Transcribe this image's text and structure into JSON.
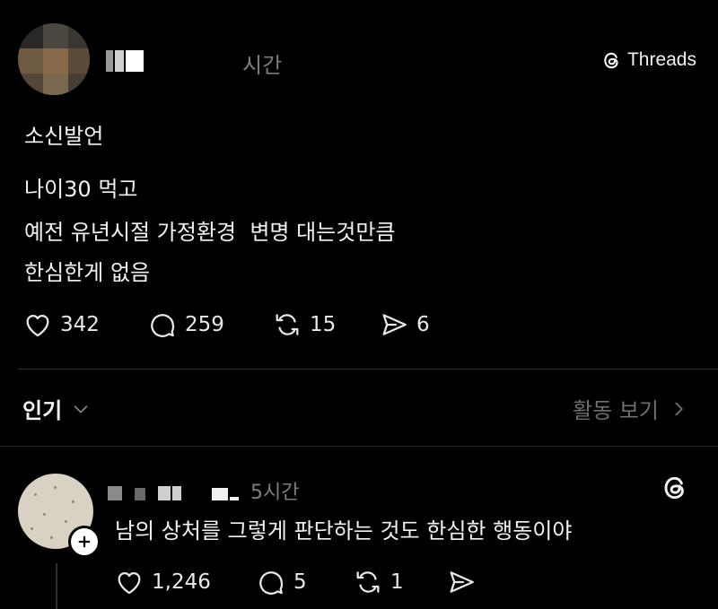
{
  "post": {
    "time": "시간",
    "source": "Threads",
    "lines": [
      "소신발언",
      "나이30 먹고",
      "예전 유년시절 가정환경  변명 대는것만큼",
      "한심한게 없음"
    ],
    "likes": "342",
    "comments": "259",
    "reposts": "15",
    "shares": "6"
  },
  "sort_bar": {
    "sort_label": "인기",
    "activity_label": "활동 보기"
  },
  "reply": {
    "time": "5시간",
    "text": "남의 상처를 그렇게 판단하는 것도 한심한 행동이야",
    "likes": "1,246",
    "comments": "5",
    "reposts": "1"
  },
  "icons": {
    "like": "heart-icon",
    "comment": "speech-bubble-icon",
    "repost": "repost-arrows-icon",
    "share": "paper-plane-icon",
    "brand": "threads-logo-icon",
    "dropdown": "chevron-down-icon",
    "activity": "chevron-right-icon",
    "follow": "plus-icon"
  },
  "colors": {
    "background": "#000000",
    "text": "#f3f3f3",
    "muted": "#7d7d7d"
  }
}
